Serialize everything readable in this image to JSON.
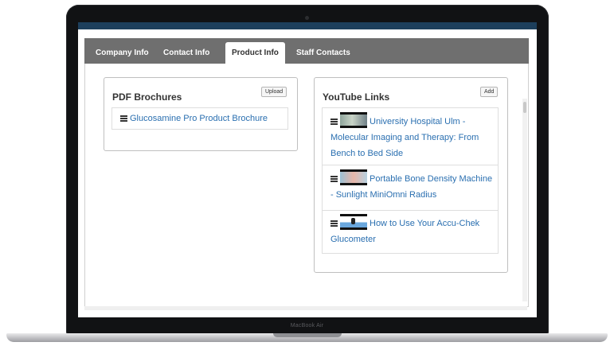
{
  "device": {
    "model_label": "MacBook Air"
  },
  "tabs": [
    {
      "label": "Company Info"
    },
    {
      "label": "Contact Info"
    },
    {
      "label": "Product Info"
    },
    {
      "label": "Staff Contacts"
    }
  ],
  "active_tab": "Product Info",
  "pdf_section": {
    "title": "PDF Brochures",
    "button_label": "Upload",
    "items": [
      {
        "label": "Glucosamine Pro Product Brochure"
      }
    ]
  },
  "youtube_section": {
    "title": "YouTube Links",
    "button_label": "Add",
    "items": [
      {
        "label": "University Hospital Ulm - Molecular Imaging and Therapy: From Bench to Bed Side"
      },
      {
        "label": "Portable Bone Density Machine - Sunlight MiniOmni Radius"
      },
      {
        "label": "How to Use Your Accu-Chek Glucometer"
      }
    ]
  },
  "colors": {
    "header_bar": "#1d3f5c",
    "tab_bar": "#6f6f6f",
    "link": "#2a6fb0"
  }
}
